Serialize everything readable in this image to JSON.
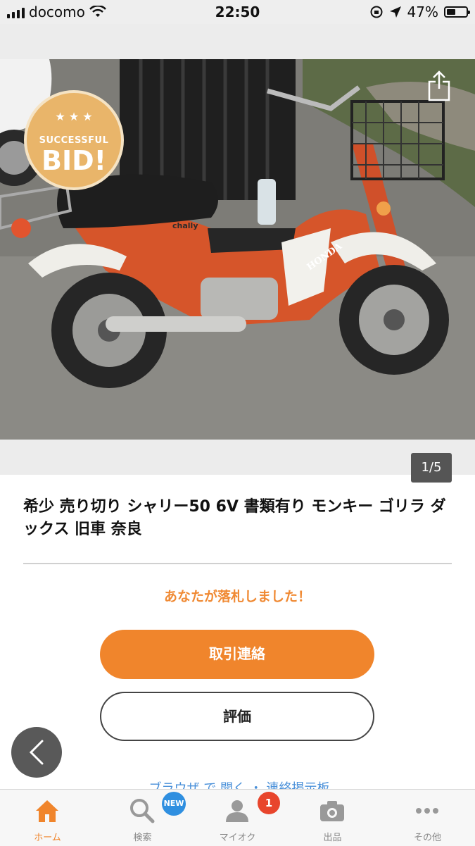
{
  "status_bar": {
    "carrier": "docomo",
    "time": "22:50",
    "battery": "47%",
    "battery_level": 0.47
  },
  "gallery": {
    "badge_top": "SUCCESSFUL",
    "badge_main": "BID!",
    "counter": "1/5",
    "photo_text": {
      "frame_logo": "HONDA",
      "side_logo": "chally"
    }
  },
  "item": {
    "title": "希少 売り切り シャリー50 6V 書類有り モンキー ゴリラ ダックス 旧車 奈良",
    "won_message": "あなたが落札しました！",
    "contact_button": "取引連絡",
    "rate_button": "評価",
    "partial_link": "ブラウザ で 開く ・ 連絡掲示板"
  },
  "tab_bar": {
    "tabs": [
      {
        "label": "ホーム",
        "icon": "home-icon",
        "active": true
      },
      {
        "label": "検索",
        "icon": "search-icon",
        "active": false
      },
      {
        "label": "マイオク",
        "icon": "person-icon",
        "active": false
      },
      {
        "label": "出品",
        "icon": "camera-icon",
        "active": false
      },
      {
        "label": "その他",
        "icon": "more-icon",
        "active": false
      }
    ],
    "search_badge": "NEW",
    "myauc_badge": "1"
  },
  "colors": {
    "accent": "#f0852c",
    "link": "#4a90d9",
    "badge_blue": "#2f8fe0",
    "badge_red": "#e8452c"
  }
}
